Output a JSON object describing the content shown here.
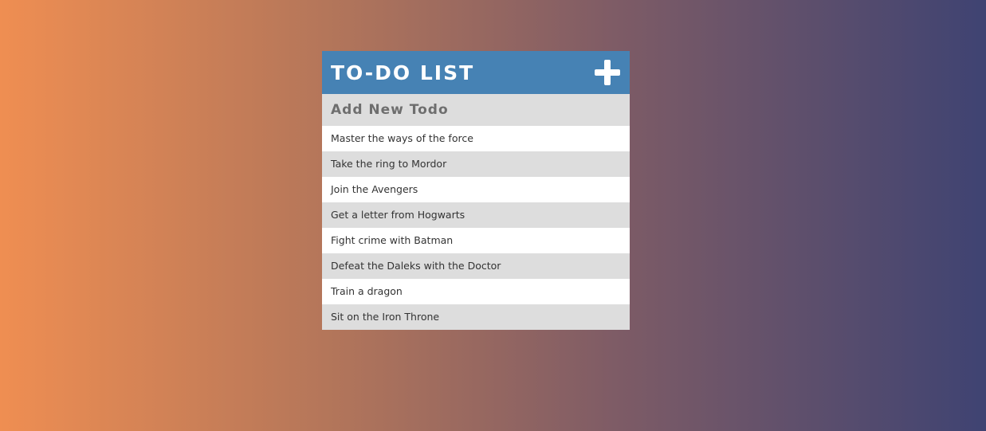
{
  "header": {
    "title": "TO-DO LIST",
    "add_icon": "plus-icon"
  },
  "new_todo": {
    "placeholder": "Add New Todo"
  },
  "todos": [
    "Master the ways of the force",
    "Take the ring to Mordor",
    "Join the Avengers",
    "Get a letter from Hogwarts",
    "Fight crime with Batman",
    "Defeat the Daleks with the Doctor",
    "Train a dragon",
    "Sit on the Iron Throne"
  ],
  "colors": {
    "header_bg": "#4682b4",
    "row_alt_bg": "#dddddd",
    "gradient_left": "#ef8e52",
    "gradient_right": "#3f4372"
  }
}
